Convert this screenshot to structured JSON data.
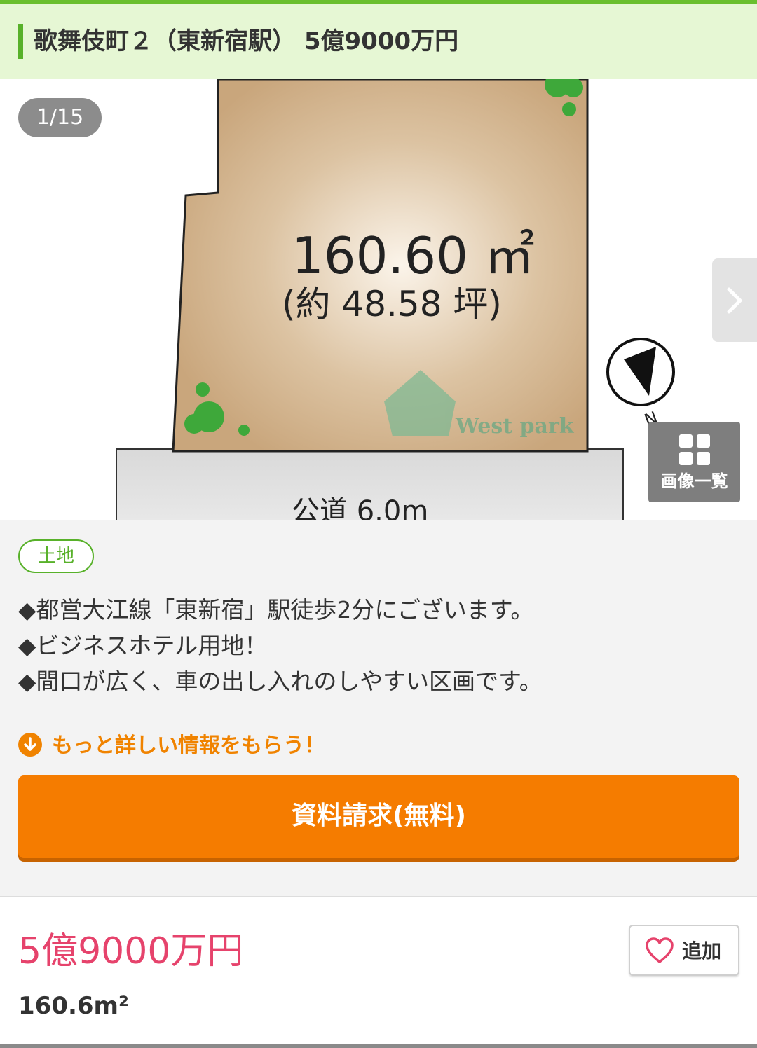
{
  "header": {
    "title": "歌舞伎町２（東新宿駅） 5億9000万円"
  },
  "gallery": {
    "counter": "1/15",
    "plot": {
      "area_main": "160.60 ㎡",
      "area_sub": "(約 48.58 坪)",
      "road": "公道 6.0m",
      "watermark": "West park",
      "compass_letter": "N"
    },
    "next_icon": "chevron-right-icon",
    "list_label": "画像一覧"
  },
  "property": {
    "type_tag": "土地",
    "description": [
      "◆都営大江線「東新宿」駅徒歩2分にございます。",
      "◆ビジネスホテル用地！",
      "◆間口が広く、車の出し入れのしやすい区画です。"
    ],
    "more_info": "もっと詳しい情報をもらう！",
    "cta_label": "資料請求(無料)",
    "price": "5億9000万円",
    "area": "160.6m²",
    "favorite_label": "追加"
  },
  "colors": {
    "brand_green": "#58b12a",
    "header_bg": "#e6f7d4",
    "cta_orange": "#f57c00",
    "price_pink": "#e6436c"
  }
}
